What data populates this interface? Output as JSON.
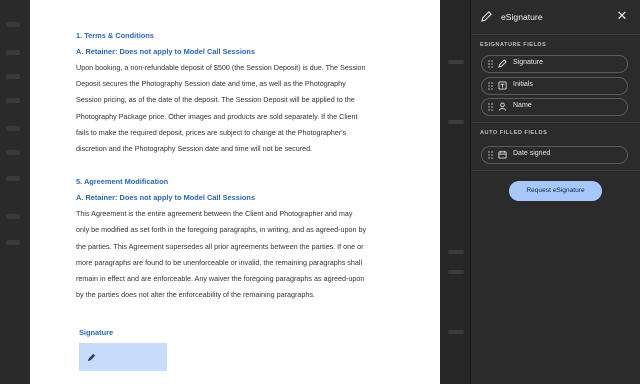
{
  "document": {
    "section1_title": "1. Terms & Conditions",
    "section1_sub": "A. Retainer:  Does not apply to Model Call Sessions",
    "section1_lines": [
      "Upon booking, a non-refundable deposit of $500 (the Session Deposit) is due. The Session",
      "Deposit secures the Photography Session date and time, as well as the Photography",
      "Session pricing, as of the date of the deposit. The Session Deposit will be applied to the",
      "Photography Package price. Other images and products are sold separately. If the Client",
      "fails to make the required deposit, prices are subject to change at the Photographer's",
      "discretion and the Photography Session date and time will not be secured."
    ],
    "section5_title": "5. Agreement Modification",
    "section5_sub": "A. Retainer:  Does not apply to Model Call Sessions",
    "section5_lines": [
      "This Agreement is the entire agreement between the Client and Photographer and may",
      "only be modified as set forth in the foregoing paragraphs, in writing, and as agreed-upon by",
      "the parties. This Agreement supersedes all prior agreements between the parties. If one or",
      "more paragraphs are found to be unenforceable or invalid, the remaining paragraphs shall",
      "remain in effect and are enforceable. Any waiver the foregoing paragraphs as agreed-upon",
      "by the parties does not alter the enforceability of the remaining paragraphs."
    ],
    "signature_label": "Signature"
  },
  "panel": {
    "title": "eSignature",
    "signature_fields_label": "ESIGNATURE FIELDS",
    "fields": [
      {
        "label": "Signature",
        "icon": "pen-icon"
      },
      {
        "label": "Initials",
        "icon": "text-icon"
      },
      {
        "label": "Name",
        "icon": "person-icon"
      }
    ],
    "auto_filled_label": "AUTO FILLED FIELDS",
    "auto_fields": [
      {
        "label": "Date signed",
        "icon": "calendar-icon"
      }
    ],
    "request_button": "Request eSignature"
  },
  "colors": {
    "accent": "#2a68b8",
    "signature_box": "#c5dcfb",
    "request_button": "#a8c7fa",
    "panel_bg": "#2b2b2b"
  }
}
